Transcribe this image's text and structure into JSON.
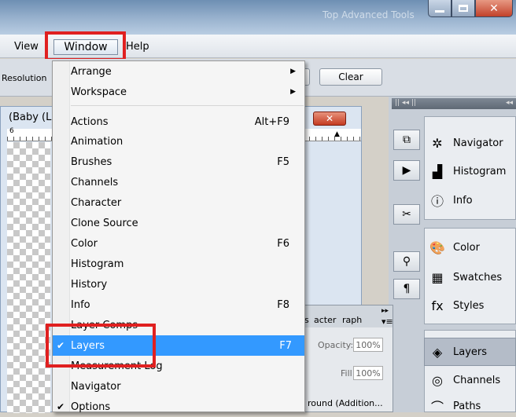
{
  "window": {
    "title": "Top Advanced Tools"
  },
  "menubar": {
    "view": "View",
    "window": "Window",
    "help": "Help"
  },
  "options_bar": {
    "resolution_label": "Resolution",
    "clear_button": "Clear"
  },
  "document": {
    "title": "(Baby (L",
    "ruler_tick": "6"
  },
  "dropdown": {
    "arrange": "Arrange",
    "workspace": "Workspace",
    "items": [
      {
        "label": "Actions",
        "shortcut": "Alt+F9"
      },
      {
        "label": "Animation",
        "shortcut": ""
      },
      {
        "label": "Brushes",
        "shortcut": "F5"
      },
      {
        "label": "Channels",
        "shortcut": ""
      },
      {
        "label": "Character",
        "shortcut": ""
      },
      {
        "label": "Clone Source",
        "shortcut": ""
      },
      {
        "label": "Color",
        "shortcut": "F6"
      },
      {
        "label": "Histogram",
        "shortcut": ""
      },
      {
        "label": "History",
        "shortcut": ""
      },
      {
        "label": "Info",
        "shortcut": "F8"
      },
      {
        "label": "Layer Comps",
        "shortcut": ""
      },
      {
        "label": "Layers",
        "shortcut": "F7",
        "checked": true
      },
      {
        "label": "Measurement Log",
        "shortcut": ""
      },
      {
        "label": "Navigator",
        "shortcut": ""
      },
      {
        "label": "Options",
        "shortcut": "",
        "checked": true
      }
    ]
  },
  "layers_panel": {
    "tabs": [
      "s",
      "acter",
      "raph"
    ],
    "opacity_label": "Opacity:",
    "opacity_value": "100%",
    "fill_label": "Fill:",
    "fill_value": "100%",
    "layer_name": "round (Addition..."
  },
  "dock": {
    "groups": [
      {
        "label": "Navigator",
        "icon": "navigator-icon"
      },
      {
        "label": "Histogram",
        "icon": "histogram-icon"
      },
      {
        "label": "Info",
        "icon": "info-icon"
      },
      {
        "label": "Color",
        "icon": "color-icon"
      },
      {
        "label": "Swatches",
        "icon": "swatches-icon"
      },
      {
        "label": "Styles",
        "icon": "styles-icon"
      },
      {
        "label": "Layers",
        "icon": "layers-icon"
      },
      {
        "label": "Channels",
        "icon": "channels-icon"
      },
      {
        "label": "Paths",
        "icon": "paths-icon"
      }
    ]
  },
  "colors": {
    "highlight": "#3399ff",
    "annotation_red": "#e02020"
  }
}
